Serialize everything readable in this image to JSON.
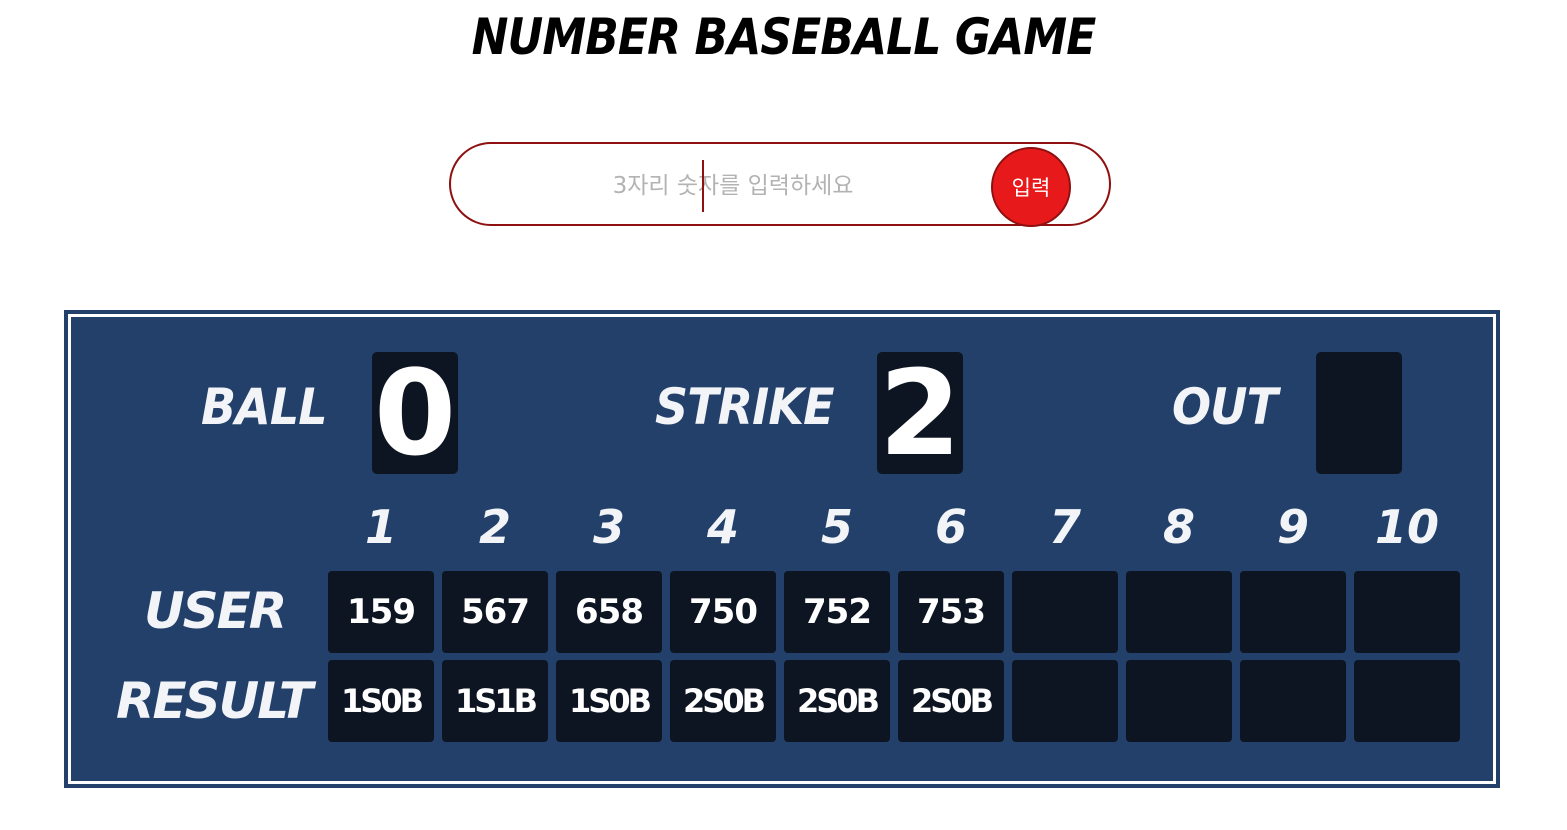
{
  "title": "NUMBER BASEBALL GAME",
  "input": {
    "placeholder": "3자리 숫자를 입력하세요",
    "value": "",
    "submit_label": "입력"
  },
  "colors": {
    "accent": "#e8191b",
    "border": "#8f1010",
    "board": "#22406a",
    "cell": "#0d1422"
  },
  "scoreboard": {
    "ball_label": "BALL",
    "ball_value": "0",
    "strike_label": "STRIKE",
    "strike_value": "2",
    "out_label": "OUT",
    "out_value": "",
    "user_label": "USER",
    "result_label": "RESULT",
    "innings": [
      "1",
      "2",
      "3",
      "4",
      "5",
      "6",
      "7",
      "8",
      "9",
      "10"
    ],
    "user_guesses": [
      "159",
      "567",
      "658",
      "750",
      "752",
      "753",
      "",
      "",
      "",
      ""
    ],
    "results": [
      "1S0B",
      "1S1B",
      "1S0B",
      "2S0B",
      "2S0B",
      "2S0B",
      "",
      "",
      "",
      ""
    ]
  }
}
